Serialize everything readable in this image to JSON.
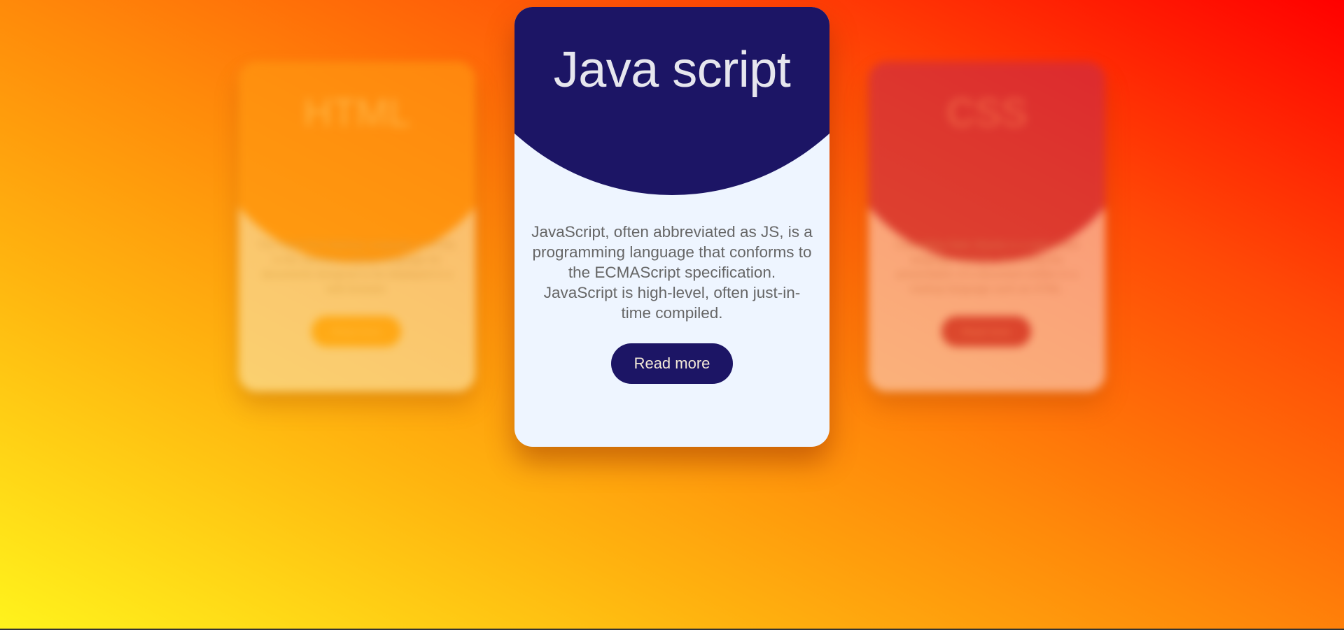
{
  "cards": {
    "html": {
      "title": "HTML",
      "description": "The HyperText Markup Language or HTML is the standard markup language for documents designed to be displayed in a web browser.",
      "button_label": "Read more"
    },
    "javascript": {
      "title": "Java script",
      "description": "JavaScript, often abbreviated as JS, is a programming language that conforms to the ECMAScript specification. JavaScript is high-level, often just-in-time compiled.",
      "button_label": "Read more"
    },
    "css": {
      "title": "CSS",
      "description": "Cascading Style Sheets is a style sheet language used for describing the presentation of a document written in a markup language such as HTML.",
      "button_label": "Read more"
    }
  },
  "colors": {
    "card_cap": "#1c1565",
    "card_body": "#eef5ff",
    "background_start": "#fff31c",
    "background_end": "#ff0000"
  }
}
